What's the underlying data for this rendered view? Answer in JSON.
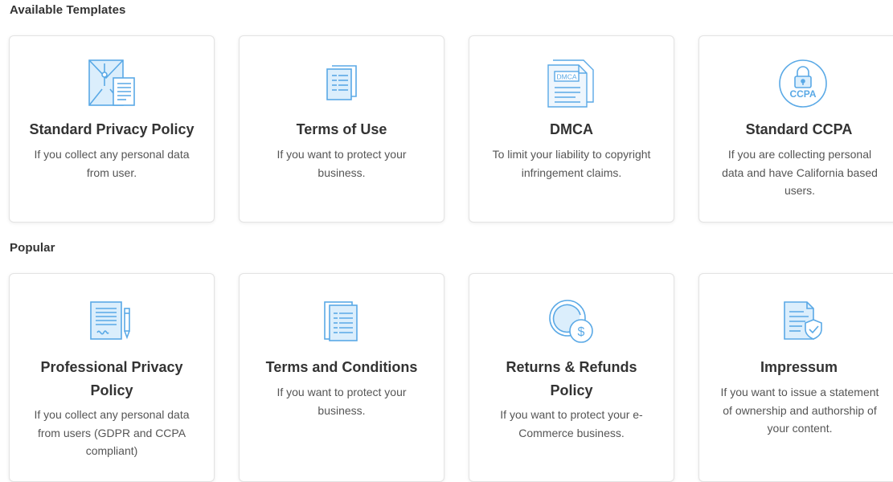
{
  "sections": {
    "available": {
      "heading": "Available Templates",
      "cards": [
        {
          "title": "Standard Privacy Policy",
          "description": "If you collect any personal data from user.",
          "icon": "envelope-document-icon"
        },
        {
          "title": "Terms of Use",
          "description": "If you want to protect your business.",
          "icon": "document-icon"
        },
        {
          "title": "DMCA",
          "description": "To limit your liability to copyright infringement claims.",
          "icon": "dmca-document-icon",
          "icon_text": "DMCA"
        },
        {
          "title": "Standard CCPA",
          "description": "If you are collecting personal data and have California based users.",
          "icon": "ccpa-lock-icon",
          "icon_text": "CCPA"
        }
      ]
    },
    "popular": {
      "heading": "Popular",
      "cards": [
        {
          "title": "Professional Privacy Policy",
          "description": "If you collect any personal data from users (GDPR and CCPA compliant)",
          "icon": "signed-document-pen-icon"
        },
        {
          "title": "Terms and Conditions",
          "description": "If you want to protect your business.",
          "icon": "document-stack-icon"
        },
        {
          "title": "Returns & Refunds Policy",
          "description": "If you want to protect your e-Commerce business.",
          "icon": "refund-dollar-icon"
        },
        {
          "title": "Impressum",
          "description": "If you want to issue a statement of ownership and authorship of your content.",
          "icon": "document-shield-icon"
        }
      ]
    }
  },
  "colors": {
    "icon_stroke": "#5aa9e6",
    "icon_fill": "#dbeefc",
    "title_text": "#333333",
    "body_text": "#555555",
    "card_border": "#e3e3e3"
  }
}
